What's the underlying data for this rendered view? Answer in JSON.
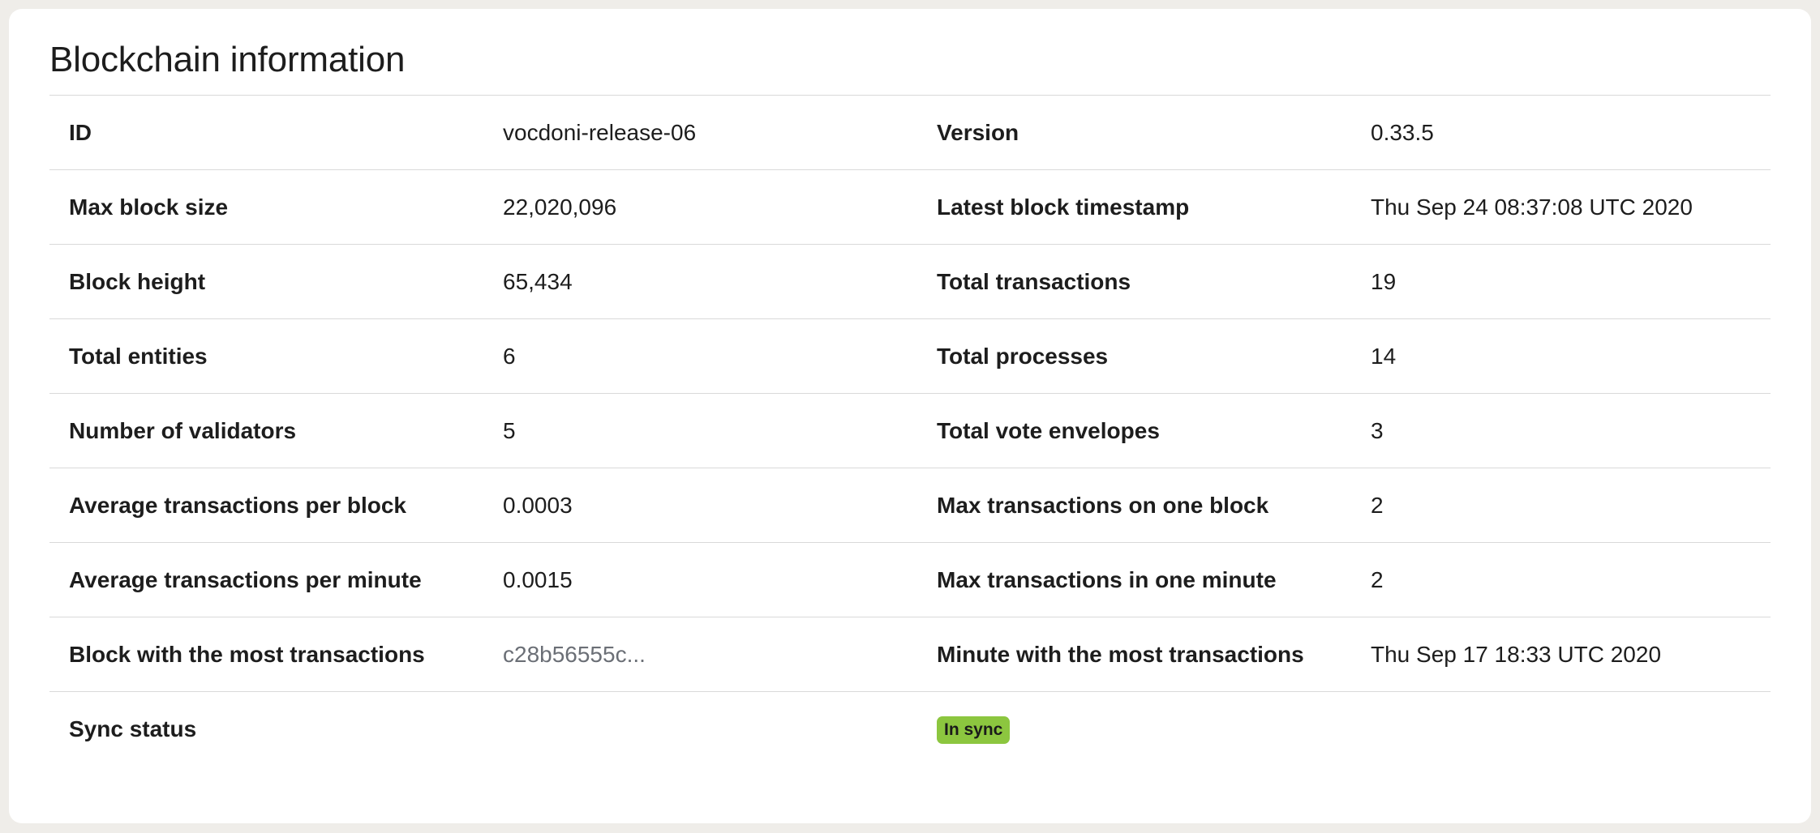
{
  "card": {
    "title": "Blockchain information"
  },
  "rows": [
    {
      "label1": "ID",
      "value1": "vocdoni-release-06",
      "label2": "Version",
      "value2": "0.33.5"
    },
    {
      "label1": "Max block size",
      "value1": "22,020,096",
      "label2": "Latest block timestamp",
      "value2": "Thu Sep 24 08:37:08 UTC 2020"
    },
    {
      "label1": "Block height",
      "value1": "65,434",
      "label2": "Total transactions",
      "value2": "19"
    },
    {
      "label1": "Total entities",
      "value1": "6",
      "label2": "Total processes",
      "value2": "14"
    },
    {
      "label1": "Number of validators",
      "value1": "5",
      "label2": "Total vote envelopes",
      "value2": "3"
    },
    {
      "label1": "Average transactions per block",
      "value1": "0.0003",
      "label2": "Max transactions on one block",
      "value2": "2"
    },
    {
      "label1": "Average transactions per minute",
      "value1": "0.0015",
      "label2": "Max transactions in one minute",
      "value2": "2"
    },
    {
      "label1": "Block with the most transactions",
      "value1": "c28b56555c...",
      "label2": "Minute with the most transactions",
      "value2": "Thu Sep 17 18:33 UTC 2020"
    }
  ],
  "sync": {
    "label": "Sync status",
    "badge": "In sync",
    "badge_color": "#8cc63f"
  },
  "colors": {
    "page_background": "#efede9",
    "card_background": "#ffffff",
    "divider": "#d9d9d9",
    "link_text": "#6b6f76"
  }
}
